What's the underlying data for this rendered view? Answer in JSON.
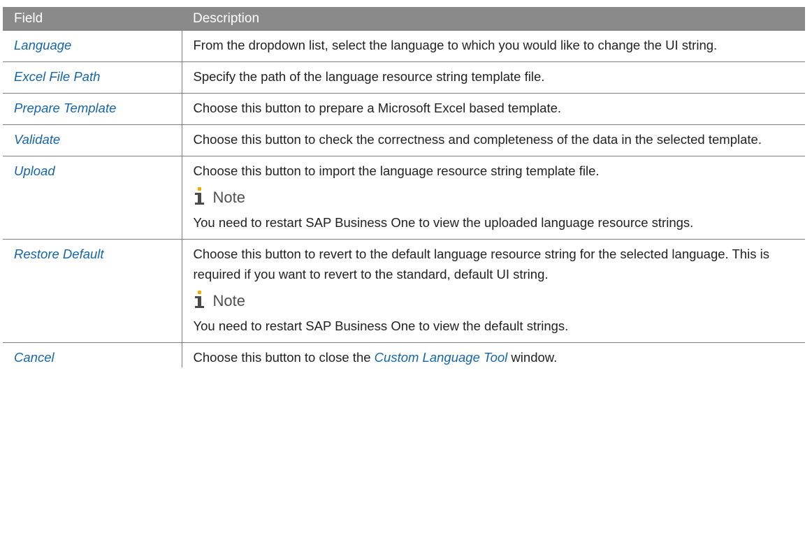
{
  "table": {
    "header": {
      "field": "Field",
      "description": "Description"
    },
    "rows": [
      {
        "field": "Language",
        "description": "From the dropdown list, select the language to which you would like to change the UI string."
      },
      {
        "field": "Excel File Path",
        "description": "Specify the path of the language resource string template file."
      },
      {
        "field": "Prepare Template",
        "description": "Choose this button to prepare a Microsoft Excel based template."
      },
      {
        "field": "Validate",
        "description": "Choose this button to check the correctness and completeness of the data in the selected template."
      },
      {
        "field": "Upload",
        "description": "Choose this button to import the language resource string template file.",
        "note_label": "Note",
        "note_text": "You need to restart SAP Business One to view the uploaded language resource strings."
      },
      {
        "field": "Restore Default",
        "description": "Choose this button to revert to the default language resource string for the selected language. This is required if you want to revert to the standard, default UI string.",
        "note_label": "Note",
        "note_text": "You need to restart SAP Business One to view the default strings."
      },
      {
        "field": "Cancel",
        "description_before": "Choose this button to close the ",
        "description_link": "Custom Language Tool",
        "description_after": " window."
      }
    ]
  },
  "colors": {
    "header_bg": "#8a8a8a",
    "field_text": "#1565a8",
    "note_dot": "#f0ab00"
  },
  "icons": {
    "note": "note-info-icon"
  }
}
